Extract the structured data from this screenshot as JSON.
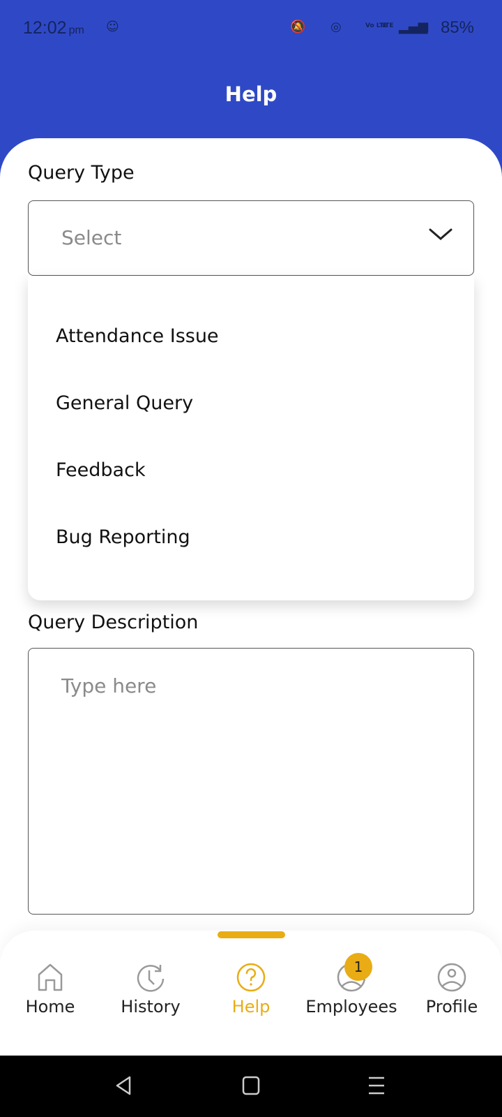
{
  "status_bar": {
    "time": "12:02",
    "ampm": "pm",
    "battery": "85%",
    "network": [
      "Vo LTE",
      "LTE"
    ]
  },
  "header": {
    "title": "Help"
  },
  "form": {
    "query_type_label": "Query Type",
    "select_placeholder": "Select",
    "options": [
      "Attendance Issue",
      "General Query",
      "Feedback",
      "Bug Reporting"
    ],
    "description_label": "Query Description",
    "description_placeholder": "Type here"
  },
  "bottom_nav": {
    "items": [
      {
        "label": "Home",
        "icon": "home-icon"
      },
      {
        "label": "History",
        "icon": "history-icon"
      },
      {
        "label": "Help",
        "icon": "help-icon",
        "active": true
      },
      {
        "label": "Employees",
        "icon": "employees-icon",
        "badge": "1"
      },
      {
        "label": "Profile",
        "icon": "profile-icon"
      }
    ]
  },
  "colors": {
    "primary": "#2f49c6",
    "accent": "#e9ac14"
  }
}
